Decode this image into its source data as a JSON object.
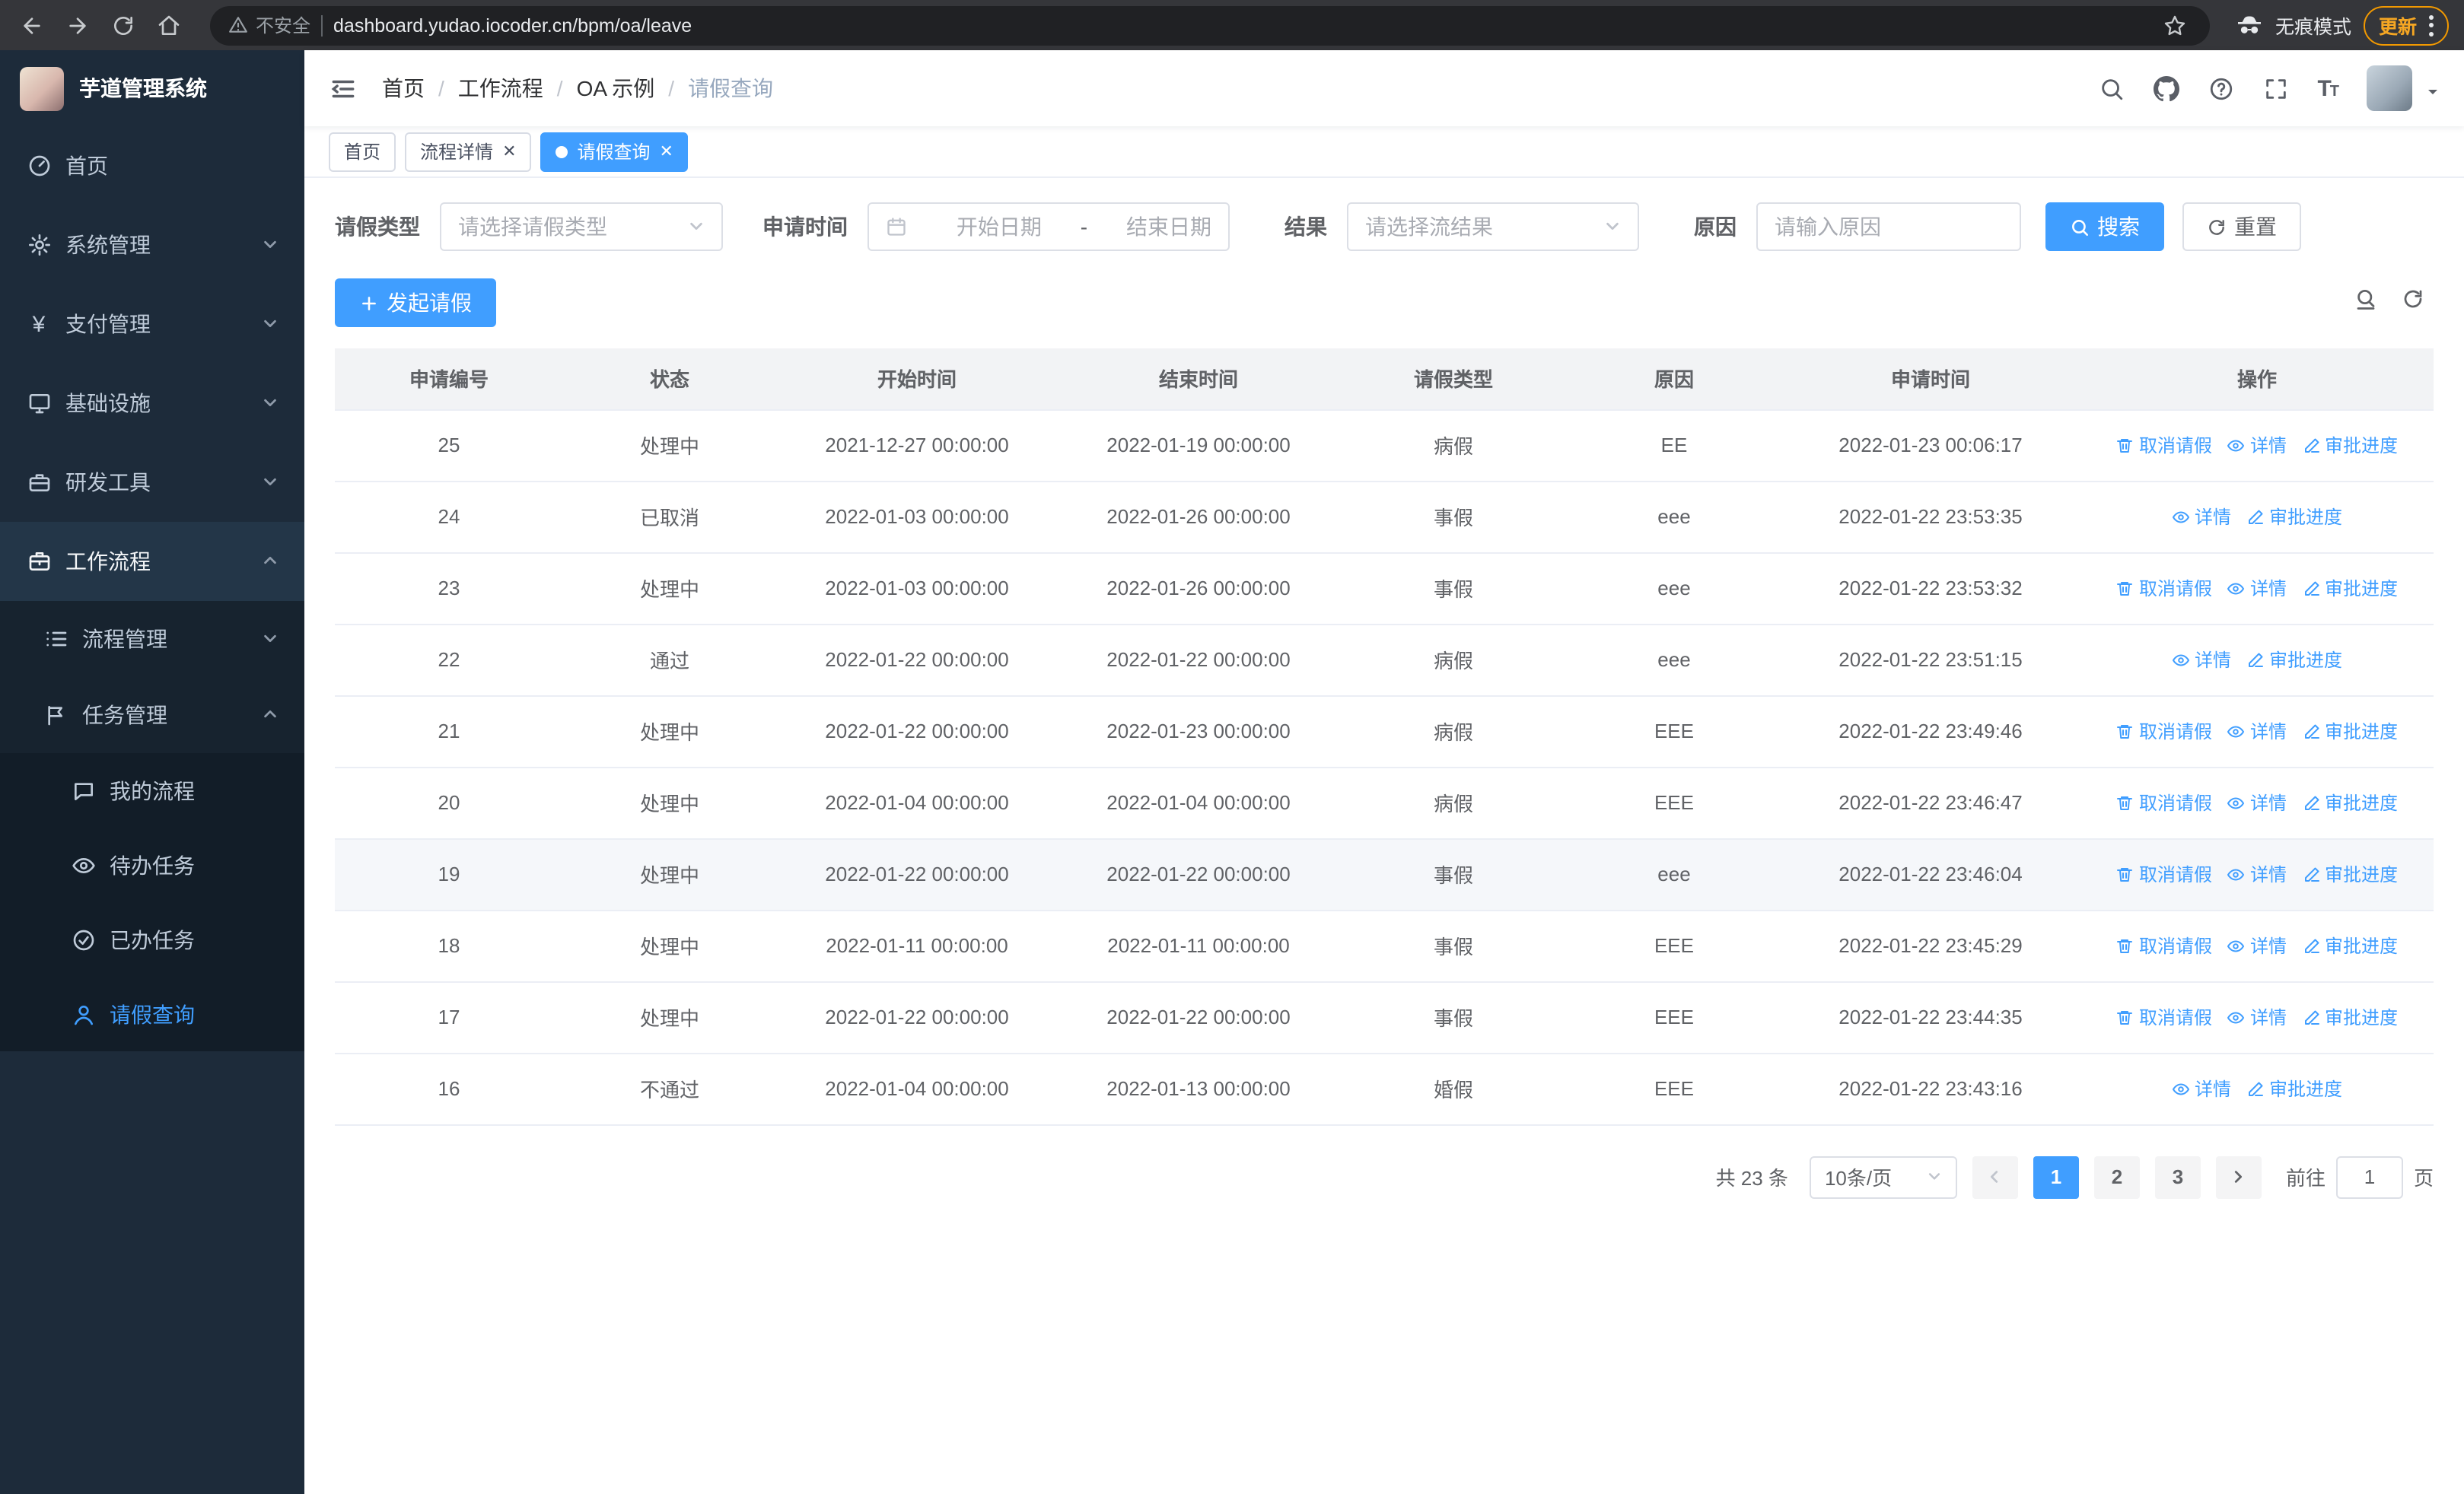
{
  "browser": {
    "security_label": "不安全",
    "url": "dashboard.yudao.iocoder.cn/bpm/oa/leave",
    "incognito_label": "无痕模式",
    "update_label": "更新"
  },
  "sidebar": {
    "logo_title": "芋道管理系统",
    "items": {
      "home": "首页",
      "system": "系统管理",
      "payment": "支付管理",
      "infra": "基础设施",
      "devtools": "研发工具",
      "workflow": "工作流程",
      "process_mgmt": "流程管理",
      "task_mgmt": "任务管理",
      "my_process": "我的流程",
      "todo_tasks": "待办任务",
      "done_tasks": "已办任务",
      "leave_query": "请假查询"
    }
  },
  "header": {
    "breadcrumb": [
      "首页",
      "工作流程",
      "OA 示例",
      "请假查询"
    ]
  },
  "tabs": [
    {
      "label": "首页"
    },
    {
      "label": "流程详情"
    },
    {
      "label": "请假查询"
    }
  ],
  "filters": {
    "leave_type_label": "请假类型",
    "leave_type_placeholder": "请选择请假类型",
    "apply_time_label": "申请时间",
    "start_date_placeholder": "开始日期",
    "range_separator": "-",
    "end_date_placeholder": "结束日期",
    "result_label": "结果",
    "result_placeholder": "请选择流结果",
    "reason_label": "原因",
    "reason_placeholder": "请输入原因",
    "search_label": "搜索",
    "reset_label": "重置"
  },
  "toolbar": {
    "create_label": "发起请假"
  },
  "table": {
    "columns": [
      "申请编号",
      "状态",
      "开始时间",
      "结束时间",
      "请假类型",
      "原因",
      "申请时间",
      "操作"
    ],
    "rows": [
      {
        "id": "25",
        "status": "处理中",
        "start_time": "2021-12-27 00:00:00",
        "end_time": "2022-01-19 00:00:00",
        "leave_type": "病假",
        "reason": "EE",
        "apply_time": "2022-01-23 00:06:17",
        "can_cancel": true,
        "highlight": false
      },
      {
        "id": "24",
        "status": "已取消",
        "start_time": "2022-01-03 00:00:00",
        "end_time": "2022-01-26 00:00:00",
        "leave_type": "事假",
        "reason": "eee",
        "apply_time": "2022-01-22 23:53:35",
        "can_cancel": false,
        "highlight": false
      },
      {
        "id": "23",
        "status": "处理中",
        "start_time": "2022-01-03 00:00:00",
        "end_time": "2022-01-26 00:00:00",
        "leave_type": "事假",
        "reason": "eee",
        "apply_time": "2022-01-22 23:53:32",
        "can_cancel": true,
        "highlight": false
      },
      {
        "id": "22",
        "status": "通过",
        "start_time": "2022-01-22 00:00:00",
        "end_time": "2022-01-22 00:00:00",
        "leave_type": "病假",
        "reason": "eee",
        "apply_time": "2022-01-22 23:51:15",
        "can_cancel": false,
        "highlight": false
      },
      {
        "id": "21",
        "status": "处理中",
        "start_time": "2022-01-22 00:00:00",
        "end_time": "2022-01-23 00:00:00",
        "leave_type": "病假",
        "reason": "EEE",
        "apply_time": "2022-01-22 23:49:46",
        "can_cancel": true,
        "highlight": false
      },
      {
        "id": "20",
        "status": "处理中",
        "start_time": "2022-01-04 00:00:00",
        "end_time": "2022-01-04 00:00:00",
        "leave_type": "病假",
        "reason": "EEE",
        "apply_time": "2022-01-22 23:46:47",
        "can_cancel": true,
        "highlight": false
      },
      {
        "id": "19",
        "status": "处理中",
        "start_time": "2022-01-22 00:00:00",
        "end_time": "2022-01-22 00:00:00",
        "leave_type": "事假",
        "reason": "eee",
        "apply_time": "2022-01-22 23:46:04",
        "can_cancel": true,
        "highlight": true
      },
      {
        "id": "18",
        "status": "处理中",
        "start_time": "2022-01-11 00:00:00",
        "end_time": "2022-01-11 00:00:00",
        "leave_type": "事假",
        "reason": "EEE",
        "apply_time": "2022-01-22 23:45:29",
        "can_cancel": true,
        "highlight": false
      },
      {
        "id": "17",
        "status": "处理中",
        "start_time": "2022-01-22 00:00:00",
        "end_time": "2022-01-22 00:00:00",
        "leave_type": "事假",
        "reason": "EEE",
        "apply_time": "2022-01-22 23:44:35",
        "can_cancel": true,
        "highlight": false
      },
      {
        "id": "16",
        "status": "不通过",
        "start_time": "2022-01-04 00:00:00",
        "end_time": "2022-01-13 00:00:00",
        "leave_type": "婚假",
        "reason": "EEE",
        "apply_time": "2022-01-22 23:43:16",
        "can_cancel": false,
        "highlight": false
      }
    ]
  },
  "ops": {
    "cancel": "取消请假",
    "detail": "详情",
    "progress": "审批进度"
  },
  "pagination": {
    "total_label": "共 23 条",
    "page_size_label": "10条/页",
    "pages": [
      "1",
      "2",
      "3"
    ],
    "active_page": "1",
    "goto_label": "前往",
    "goto_value": "1",
    "page_suffix": "页"
  },
  "colors": {
    "primary": "#409eff",
    "sidebar_bg": "#1d2b3a",
    "update_orange": "#f29900"
  }
}
